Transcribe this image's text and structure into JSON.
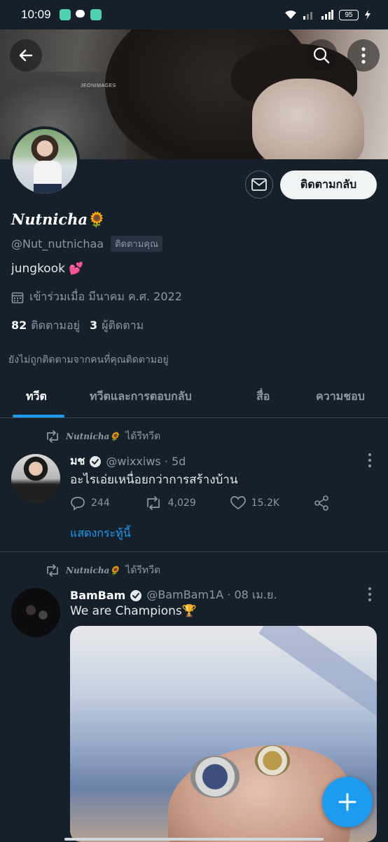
{
  "status_bar": {
    "time": "10:09",
    "battery": "95"
  },
  "banner": {
    "watermark": "JEONIMAGES"
  },
  "profile": {
    "name": "Nutnicha",
    "name_emoji": "🌻",
    "handle": "@Nut_nutnichaa",
    "follows_you": "ติดตามคุณ",
    "bio": "jungkook 💕",
    "joined": "เข้าร่วมเมื่อ มีนาคม ค.ศ. 2022",
    "following_count": "82",
    "following_label": "ติดตามอยู่",
    "followers_count": "3",
    "followers_label": "ผู้ติดตาม",
    "not_followed_note": "ยังไม่ถูกติดตามจากคนที่คุณติดตามอยู่",
    "follow_back_button": "ติดตามกลับ"
  },
  "tabs": [
    {
      "label": "ทวีต",
      "active": true
    },
    {
      "label": "ทวีตและการตอบกลับ",
      "active": false
    },
    {
      "label": "สื่อ",
      "active": false
    },
    {
      "label": "ความชอบ",
      "active": false
    }
  ],
  "tweets": [
    {
      "retweeted_by": "Nutnicha🌻",
      "retweet_label": "ได้รีทวีต",
      "display_name": "มช",
      "handle": "@wixxiws · 5d",
      "text": "อะไรเอ่ยเหนื่อยกว่าการสร้างบ้าน",
      "replies": "244",
      "retweets": "4,029",
      "likes": "15.2K",
      "show_thread": "แสดงกระทู้นี้"
    },
    {
      "retweeted_by": "Nutnicha🌻",
      "retweet_label": "ได้รีทวีต",
      "display_name": "BamBam",
      "handle": "@BamBam1A · 08 เม.ย.",
      "text": "We are Champions🏆"
    }
  ],
  "colors": {
    "background": "#15202b",
    "accent": "#1d9bf0",
    "muted": "#8b98a5",
    "divider": "#38444d"
  }
}
